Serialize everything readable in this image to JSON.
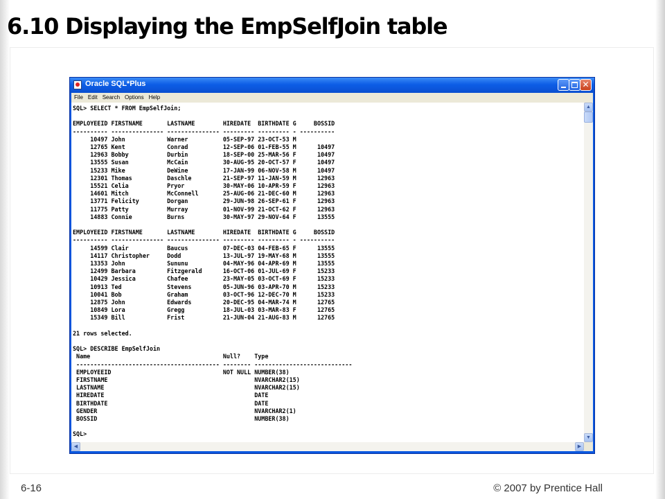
{
  "slide": {
    "title": "6.10 Displaying the EmpSelfJoin table",
    "page_number": "6-16",
    "copyright": "© 2007 by Prentice Hall"
  },
  "window": {
    "title": "Oracle SQL*Plus",
    "menu": [
      "File",
      "Edit",
      "Search",
      "Options",
      "Help"
    ],
    "title_bar_color": "#0a58e0",
    "console_background": "#ffffff",
    "icons": {
      "minimize": "minimize-icon",
      "maximize": "maximize-icon",
      "close": "close-icon",
      "scroll_up": "arrow-up-icon",
      "scroll_down": "arrow-down-icon",
      "scroll_left": "arrow-left-icon",
      "scroll_right": "arrow-right-icon"
    }
  },
  "console": {
    "lines": [
      "SQL> SELECT * FROM EmpSelfJoin;",
      "",
      "EMPLOYEEID FIRSTNAME       LASTNAME        HIREDATE  BIRTHDATE G     BOSSID",
      "---------- --------------- --------------- --------- --------- - ----------",
      "     10497 John            Warner          05-SEP-97 23-OCT-53 M",
      "     12765 Kent            Conrad          12-SEP-06 01-FEB-55 M      10497",
      "     12963 Bobby           Durbin          18-SEP-00 25-MAR-56 F      10497",
      "     13555 Susan           McCain          30-AUG-95 20-OCT-57 F      10497",
      "     15233 Mike            DeWine          17-JAN-99 06-NOV-58 M      10497",
      "     12301 Thomas          Daschle         21-SEP-97 11-JAN-59 M      12963",
      "     15521 Celia           Pryor           30-MAY-06 10-APR-59 F      12963",
      "     14601 Mitch           McConnell       25-AUG-06 21-DEC-60 M      12963",
      "     13771 Felicity        Dorgan          29-JUN-98 26-SEP-61 F      12963",
      "     11775 Patty           Murray          01-NOV-99 21-OCT-62 F      12963",
      "     14883 Connie          Burns           30-MAY-97 29-NOV-64 F      13555",
      "",
      "EMPLOYEEID FIRSTNAME       LASTNAME        HIREDATE  BIRTHDATE G     BOSSID",
      "---------- --------------- --------------- --------- --------- - ----------",
      "     14599 Clair           Baucus          07-DEC-03 04-FEB-65 F      13555",
      "     14117 Christopher     Dodd            13-JUL-97 19-MAY-68 M      13555",
      "     13353 John            Sununu          04-MAY-96 04-APR-69 M      13555",
      "     12499 Barbara         Fitzgerald      16-OCT-06 01-JUL-69 F      15233",
      "     10429 Jessica         Chafee          23-MAY-05 03-OCT-69 F      15233",
      "     10913 Ted             Stevens         05-JUN-96 03-APR-70 M      15233",
      "     10041 Bob             Graham          03-OCT-96 12-DEC-70 M      15233",
      "     12875 John            Edwards         20-DEC-95 04-MAR-74 M      12765",
      "     10849 Lora            Gregg           18-JUL-03 03-MAR-83 F      12765",
      "     15349 Bill            Frist           21-JUN-04 21-AUG-83 M      12765",
      "",
      "21 rows selected.",
      "",
      "SQL> DESCRIBE EmpSelfJoin",
      " Name                                      Null?    Type",
      " ----------------------------------------- -------- ----------------------------",
      " EMPLOYEEID                                NOT NULL NUMBER(38)",
      " FIRSTNAME                                          NVARCHAR2(15)",
      " LASTNAME                                           NVARCHAR2(15)",
      " HIREDATE                                           DATE",
      " BIRTHDATE                                          DATE",
      " GENDER                                             NVARCHAR2(1)",
      " BOSSID                                             NUMBER(38)",
      "",
      "SQL>"
    ]
  }
}
